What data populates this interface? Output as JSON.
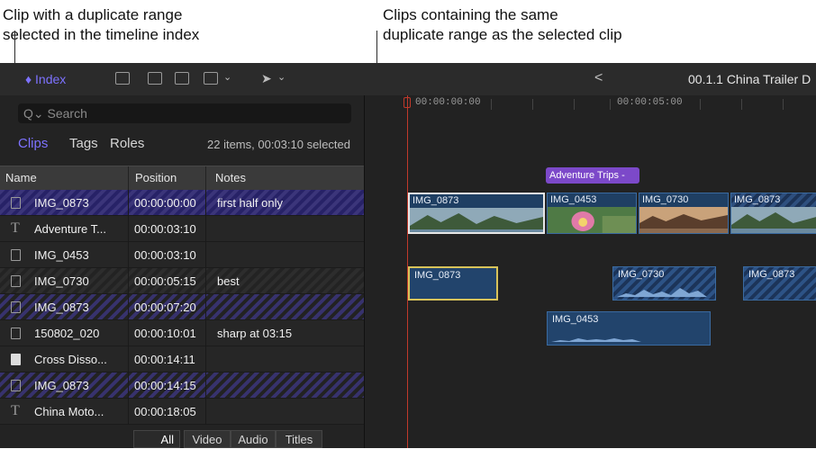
{
  "callouts": {
    "left": {
      "line1": "Clip with a duplicate range",
      "line2": "selected in the timeline index"
    },
    "right": {
      "line1": "Clips containing the same",
      "line2": "duplicate range as the selected clip"
    }
  },
  "toolbar": {
    "index_label": "Index",
    "back_label": "<",
    "project_title": "00.1.1 China Trailer D"
  },
  "index": {
    "search_placeholder": "Search",
    "tabs": {
      "clips": "Clips",
      "tags": "Tags",
      "roles": "Roles"
    },
    "count": "22 items, 00:03:10 selected",
    "columns": {
      "name": "Name",
      "position": "Position",
      "notes": "Notes"
    },
    "rows": [
      {
        "name": "IMG_0873",
        "position": "00:00:00:00",
        "notes": "first half only",
        "icon": "film-icon",
        "state": "selected"
      },
      {
        "name": "Adventure T...",
        "position": "00:00:03:10",
        "notes": "",
        "icon": "title-icon",
        "state": "normal"
      },
      {
        "name": "IMG_0453",
        "position": "00:00:03:10",
        "notes": "",
        "icon": "film-icon",
        "state": "normal"
      },
      {
        "name": "IMG_0730",
        "position": "00:00:05:15",
        "notes": "best",
        "icon": "film-icon",
        "state": "stripe"
      },
      {
        "name": "IMG_0873",
        "position": "00:00:07:20",
        "notes": "",
        "icon": "film-icon",
        "state": "duplicate"
      },
      {
        "name": "150802_020",
        "position": "00:00:10:01",
        "notes": "sharp at 03:15",
        "icon": "film-icon",
        "state": "normal"
      },
      {
        "name": "Cross Disso...",
        "position": "00:00:14:11",
        "notes": "",
        "icon": "transition-icon",
        "state": "normal"
      },
      {
        "name": "IMG_0873",
        "position": "00:00:14:15",
        "notes": "",
        "icon": "film-icon",
        "state": "duplicate"
      },
      {
        "name": "China Moto...",
        "position": "00:00:18:05",
        "notes": "",
        "icon": "title-icon",
        "state": "normal"
      }
    ],
    "bottom_tabs": {
      "all": "All",
      "video": "Video",
      "audio": "Audio",
      "titles": "Titles"
    }
  },
  "timeline": {
    "ruler": {
      "t0": "00:00:00:00",
      "t5": "00:00:05:00"
    },
    "title_clip": "Adventure Trips -",
    "video_clips": [
      "IMG_0873",
      "IMG_0453",
      "IMG_0730",
      "IMG_0873"
    ],
    "audio_clips": [
      "IMG_0873",
      "IMG_0730",
      "IMG_0873"
    ],
    "connected_audio": "IMG_0453"
  },
  "colors": {
    "accent": "#7d72ff",
    "selection": "#3b357a",
    "playhead": "#c0392b",
    "title_clip": "#7c49c9"
  }
}
